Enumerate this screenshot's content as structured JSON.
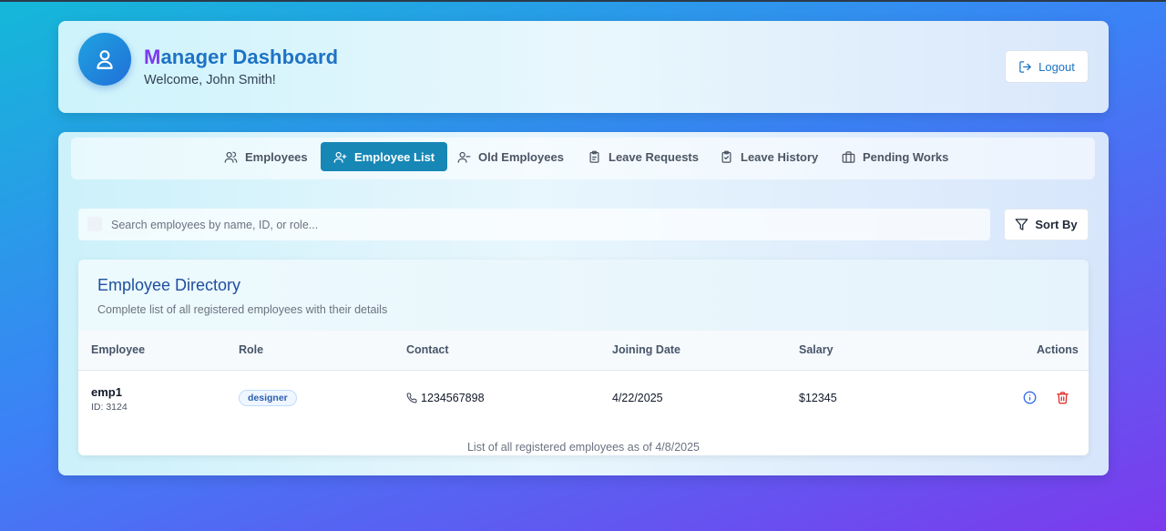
{
  "header": {
    "title_first": "M",
    "title_rest": "anager Dashboard",
    "welcome": "Welcome, John Smith!",
    "logout_label": "Logout"
  },
  "tabs": [
    {
      "label": "Employees",
      "icon": "users-icon",
      "active": false
    },
    {
      "label": "Employee List",
      "icon": "user-plus-icon",
      "active": true
    },
    {
      "label": "Old Employees",
      "icon": "user-minus-icon",
      "active": false
    },
    {
      "label": "Leave Requests",
      "icon": "clipboard-icon",
      "active": false
    },
    {
      "label": "Leave History",
      "icon": "clipboard-check-icon",
      "active": false
    },
    {
      "label": "Pending Works",
      "icon": "briefcase-icon",
      "active": false
    }
  ],
  "search": {
    "placeholder": "Search employees by name, ID, or role...",
    "value": ""
  },
  "sort_label": "Sort By",
  "directory": {
    "title": "Employee Directory",
    "subtitle": "Complete list of all registered employees with their details",
    "columns": [
      "Employee",
      "Role",
      "Contact",
      "Joining Date",
      "Salary",
      "Actions"
    ],
    "rows": [
      {
        "name": "emp1",
        "id": "ID: 3124",
        "role": "designer",
        "contact": "1234567898",
        "joining_date": "4/22/2025",
        "salary": "$12345"
      }
    ],
    "footnote": "List of all registered employees as of 4/8/2025"
  },
  "colors": {
    "accent": "#1787b6",
    "title": "#1e73c4",
    "delete": "#dc2626"
  }
}
